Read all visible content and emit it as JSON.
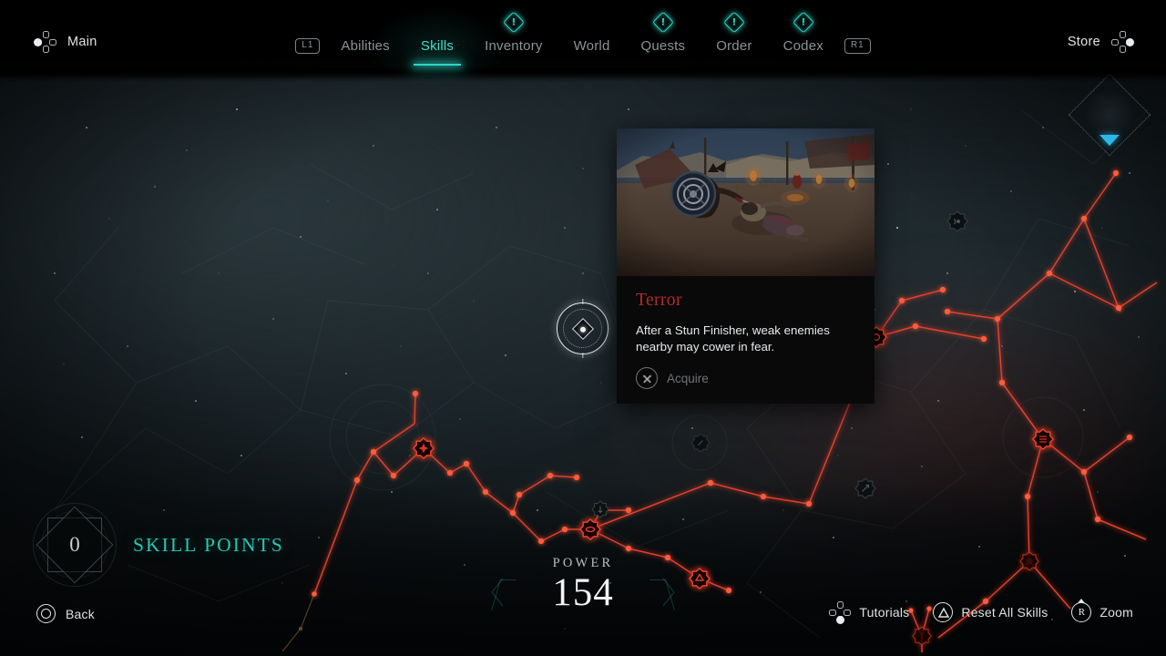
{
  "header": {
    "left_label": "Main",
    "left_icon": "dpad-left-icon",
    "right_label": "Store",
    "right_icon": "dpad-right-icon",
    "bumper_left": "L1",
    "bumper_right": "R1",
    "tabs": [
      {
        "label": "Abilities",
        "active": false,
        "badge": false
      },
      {
        "label": "Skills",
        "active": true,
        "badge": false
      },
      {
        "label": "Inventory",
        "active": false,
        "badge": true
      },
      {
        "label": "World",
        "active": false,
        "badge": false
      },
      {
        "label": "Quests",
        "active": false,
        "badge": true
      },
      {
        "label": "Order",
        "active": false,
        "badge": true
      },
      {
        "label": "Codex",
        "active": false,
        "badge": true
      }
    ]
  },
  "tooltip_card": {
    "title": "Terror",
    "description": "After a Stun Finisher, weak enemies nearby may cower in fear.",
    "action_label": "Acquire",
    "action_button_icon": "cross-button-icon",
    "action_enabled": false,
    "title_color": "#b32a26"
  },
  "skill_points": {
    "value": "0",
    "label": "SKILL POINTS",
    "accent_color": "#28c6b4"
  },
  "power": {
    "label": "POWER",
    "value": "154"
  },
  "prompts": {
    "back": {
      "label": "Back",
      "icon": "circle-button-icon"
    },
    "tutorials": {
      "label": "Tutorials",
      "icon": "dpad-down-icon"
    },
    "reset": {
      "label": "Reset All Skills",
      "icon": "triangle-button-icon"
    },
    "zoom": {
      "label": "Zoom",
      "icon": "right-stick-icon"
    }
  },
  "minimap": {
    "name": "skill-tree-overview",
    "pointer_color": "#2bb8e8"
  },
  "theme": {
    "accent_teal": "#2fd6c6",
    "node_red": "#e8412f",
    "background": "#1b2428",
    "text_primary": "#e6eaec",
    "text_dim": "#8b9396"
  },
  "skill_tree": {
    "selected_node": "terror",
    "nodes_acquired_color": "#f0452f",
    "nodes_locked_color": "#1a1c1d"
  }
}
